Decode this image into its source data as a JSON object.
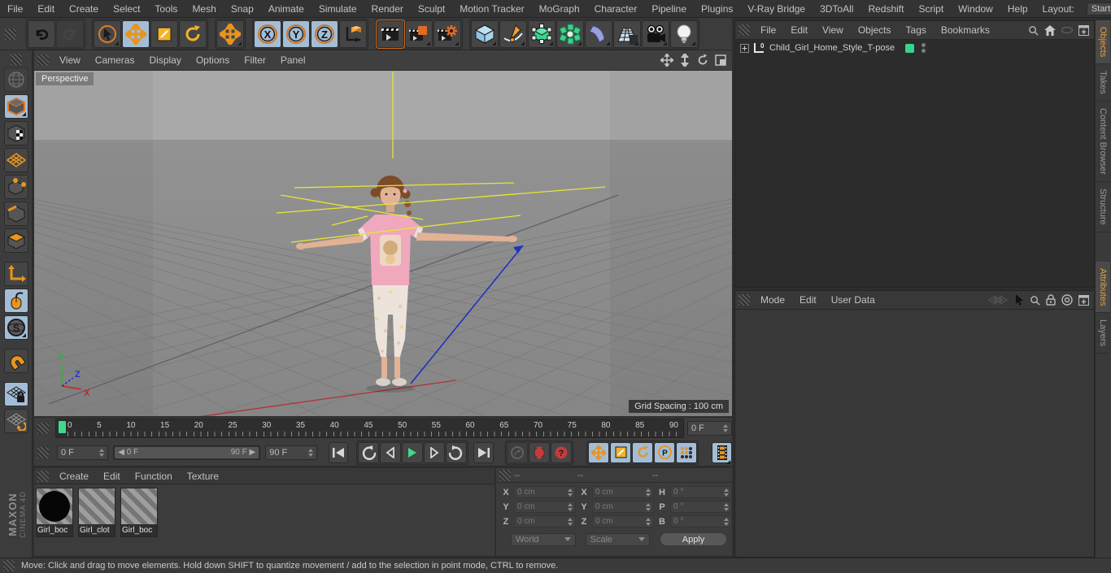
{
  "menubar": {
    "items": [
      "File",
      "Edit",
      "Create",
      "Select",
      "Tools",
      "Mesh",
      "Snap",
      "Animate",
      "Simulate",
      "Render",
      "Sculpt",
      "Motion Tracker",
      "MoGraph",
      "Character",
      "Pipeline",
      "Plugins",
      "V-Ray Bridge",
      "3DToAll",
      "Redshift",
      "Script",
      "Window",
      "Help"
    ],
    "layout_label": "Layout:",
    "layout_value": "Startup"
  },
  "viewport": {
    "menu": [
      "View",
      "Cameras",
      "Display",
      "Options",
      "Filter",
      "Panel"
    ],
    "camera_label": "Perspective",
    "grid_spacing": "Grid Spacing : 100 cm",
    "axis_labels": {
      "x": "X",
      "y": "Y",
      "z": "Z"
    },
    "axis_colors": {
      "x": "#cc2222",
      "y": "#22bb33",
      "z": "#2233cc"
    }
  },
  "timeline": {
    "ticks": [
      "0",
      "5",
      "10",
      "15",
      "20",
      "25",
      "30",
      "35",
      "40",
      "45",
      "50",
      "55",
      "60",
      "65",
      "70",
      "75",
      "80",
      "85",
      "90"
    ],
    "frame_box": "0 F"
  },
  "transport": {
    "current": "0 F",
    "range_start": "0 F",
    "range_end": "90 F",
    "end_box": "90 F",
    "parameter_letter": "P",
    "question_mark": "?"
  },
  "materials_panel": {
    "menu": [
      "Create",
      "Edit",
      "Function",
      "Texture"
    ],
    "materials": [
      "Girl_boc",
      "Girl_clot",
      "Girl_boc"
    ]
  },
  "coordinates_panel": {
    "headers": [
      "--",
      "--",
      "--"
    ],
    "position_labels": [
      "X",
      "Y",
      "Z"
    ],
    "size_labels": [
      "X",
      "Y",
      "Z"
    ],
    "rotation_labels": [
      "H",
      "P",
      "B"
    ],
    "position_values": [
      "0 cm",
      "0 cm",
      "0 cm"
    ],
    "size_values": [
      "0 cm",
      "0 cm",
      "0 cm"
    ],
    "rotation_values": [
      "0 °",
      "0 °",
      "0 °"
    ],
    "dropdown_world": "World",
    "dropdown_scale": "Scale",
    "apply_label": "Apply"
  },
  "objects_panel": {
    "menu": [
      "File",
      "Edit",
      "View",
      "Objects",
      "Tags",
      "Bookmarks"
    ],
    "object_name": "Child_Girl_Home_Style_T-pose",
    "layer_color": "#35d58b"
  },
  "attributes_panel": {
    "menu": [
      "Mode",
      "Edit",
      "User Data"
    ]
  },
  "right_tabs": {
    "top": [
      "Objects",
      "Takes",
      "Content Browser",
      "Structure"
    ],
    "bottom": [
      "Attributes",
      "Layers"
    ]
  },
  "statusbar": {
    "text": "Move: Click and drag to move elements. Hold down SHIFT to quantize movement / add to the selection in point mode, CTRL to remove."
  },
  "branding": {
    "line1": "MAXON",
    "line2": "CINEMA 4D"
  },
  "accent_colors": {
    "orange": "#ef9b31",
    "blue_highlight": "#a3bdd6",
    "yellow": "#f5c331",
    "green_play": "#3fd98a",
    "red": "#c43b3b"
  }
}
